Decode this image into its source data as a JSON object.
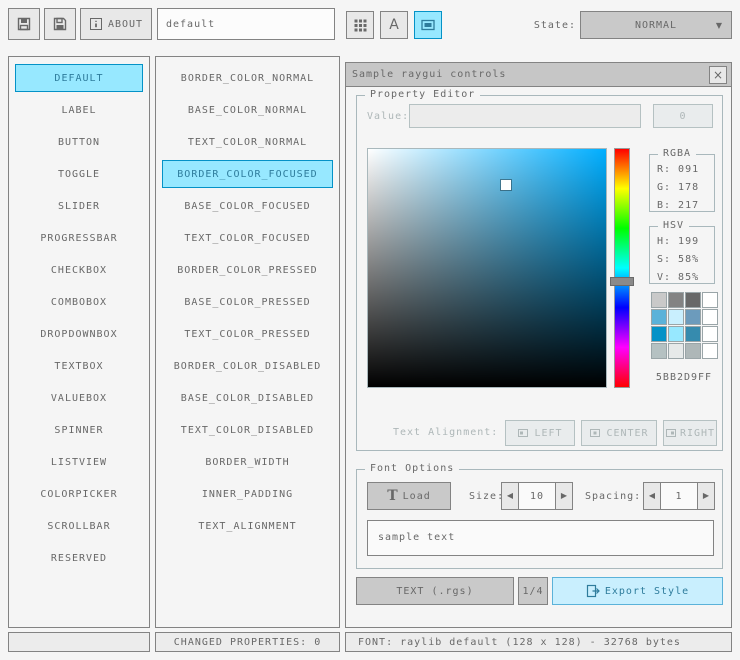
{
  "toolbar": {
    "about_label": "ABOUT",
    "name_value": "default",
    "state_label": "State:",
    "state_value": "NORMAL"
  },
  "icons": {
    "font_button": "A",
    "load_glyph": "T",
    "close": "×",
    "left_arrow": "◀",
    "right_arrow": "▶",
    "dropdown_arrow": "▼"
  },
  "controls_list": {
    "selected_index": 0,
    "items": [
      "DEFAULT",
      "LABEL",
      "BUTTON",
      "TOGGLE",
      "SLIDER",
      "PROGRESSBAR",
      "CHECKBOX",
      "COMBOBOX",
      "DROPDOWNBOX",
      "TEXTBOX",
      "VALUEBOX",
      "SPINNER",
      "LISTVIEW",
      "COLORPICKER",
      "SCROLLBAR",
      "RESERVED"
    ]
  },
  "properties_list": {
    "selected_index": 3,
    "items": [
      "BORDER_COLOR_NORMAL",
      "BASE_COLOR_NORMAL",
      "TEXT_COLOR_NORMAL",
      "BORDER_COLOR_FOCUSED",
      "BASE_COLOR_FOCUSED",
      "TEXT_COLOR_FOCUSED",
      "BORDER_COLOR_PRESSED",
      "BASE_COLOR_PRESSED",
      "TEXT_COLOR_PRESSED",
      "BORDER_COLOR_DISABLED",
      "BASE_COLOR_DISABLED",
      "TEXT_COLOR_DISABLED",
      "BORDER_WIDTH",
      "INNER_PADDING",
      "TEXT_ALIGNMENT"
    ]
  },
  "sample_window": {
    "title": "Sample raygui controls",
    "property_editor": {
      "title": "Property Editor",
      "value_label": "Value:",
      "value_text": "",
      "value_button": "0",
      "picker": {
        "h": 199,
        "s": 58,
        "v": 85
      },
      "rgba": {
        "title": "RGBA",
        "r": "R: 091",
        "g": "G: 178",
        "b": "B: 217"
      },
      "hsv": {
        "title": "HSV",
        "h": "H: 199",
        "s": "S: 58%",
        "v": "V: 85%"
      },
      "hex": "5BB2D9FF",
      "palette": [
        "#c9c9c9",
        "#838383",
        "#686868",
        "#ffffff",
        "#5bb2d9",
        "#c9effe",
        "#6c9bbc",
        "#ffffff",
        "#0492c7",
        "#97e8ff",
        "#368bae",
        "#ffffff",
        "#b5c1c2",
        "#e6e9e9",
        "#aeb7b8",
        "#ffffff"
      ],
      "text_alignment_label": "Text Alignment:",
      "align_left": "LEFT",
      "align_center": "CENTER",
      "align_right": "RIGHT"
    },
    "font_options": {
      "title": "Font Options",
      "load_label": "Load",
      "size_label": "Size:",
      "size_value": "10",
      "spacing_label": "Spacing:",
      "spacing_value": "1",
      "sample_text": "sample text"
    },
    "export_bar": {
      "text_rgs": "TEXT (.rgs)",
      "pager": "1/4",
      "export_label": "Export Style"
    }
  },
  "statusbar": {
    "changed": "CHANGED PROPERTIES: 0",
    "font_info": "FONT: raylib default (128 x 128) - 32768 bytes"
  },
  "colors": {
    "bg": "#f5f5f5",
    "border": "#838383",
    "text": "#686868",
    "textDis": "#aeb7b8",
    "borderDis": "#b5c1c2",
    "baseDis": "#e9eced",
    "btn": "#e8e8e8",
    "btnGray": "#c9c9c9",
    "selBorder": "#0492c7",
    "selBase": "#97e8ff",
    "selText": "#2e7c9c",
    "focusBorder": "#5bb2d9",
    "focusBase": "#c9effe",
    "line": "#a9b8bc",
    "titlebar": "#c6c6c6"
  }
}
